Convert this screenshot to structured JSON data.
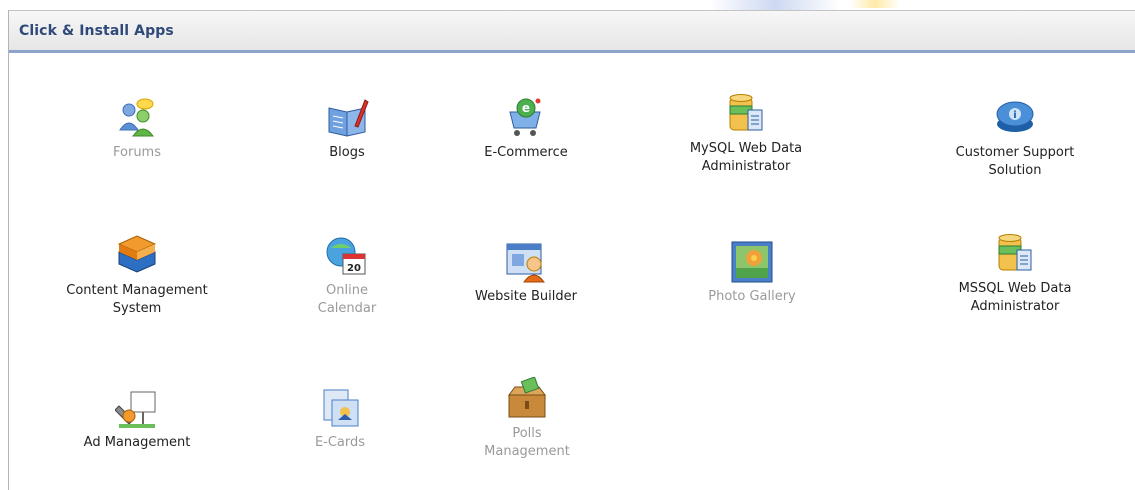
{
  "panel": {
    "title": "Click & Install Apps"
  },
  "apps": [
    {
      "label": "Forums",
      "icon": "forums-icon",
      "enabled": false
    },
    {
      "label": "Blogs",
      "icon": "blogs-icon",
      "enabled": true
    },
    {
      "label": "E-Commerce",
      "icon": "ecommerce-icon",
      "enabled": true
    },
    {
      "label": "MySQL Web Data\nAdministrator",
      "icon": "mysql-database-icon",
      "enabled": true
    },
    {
      "label": "Customer Support\nSolution",
      "icon": "customer-support-icon",
      "enabled": true
    },
    {
      "label": "Content Management\nSystem",
      "icon": "content-management-icon",
      "enabled": true
    },
    {
      "label": "Online\nCalendar",
      "icon": "calendar-icon",
      "enabled": false,
      "calendar_day": "20"
    },
    {
      "label": "Website Builder",
      "icon": "website-builder-icon",
      "enabled": true
    },
    {
      "label": "Photo Gallery",
      "icon": "photo-gallery-icon",
      "enabled": false
    },
    {
      "label": "MSSQL Web Data\nAdministrator",
      "icon": "mssql-database-icon",
      "enabled": true
    },
    {
      "label": "Ad Management",
      "icon": "ad-management-icon",
      "enabled": true
    },
    {
      "label": "E-Cards",
      "icon": "ecards-icon",
      "enabled": false
    },
    {
      "label": "Polls\nManagement",
      "icon": "polls-icon",
      "enabled": false
    }
  ],
  "colors": {
    "header_text": "#2f4a7a",
    "header_underline": "#8ea3cc",
    "enabled_label": "#222222",
    "disabled_label": "#9a9a9a"
  }
}
